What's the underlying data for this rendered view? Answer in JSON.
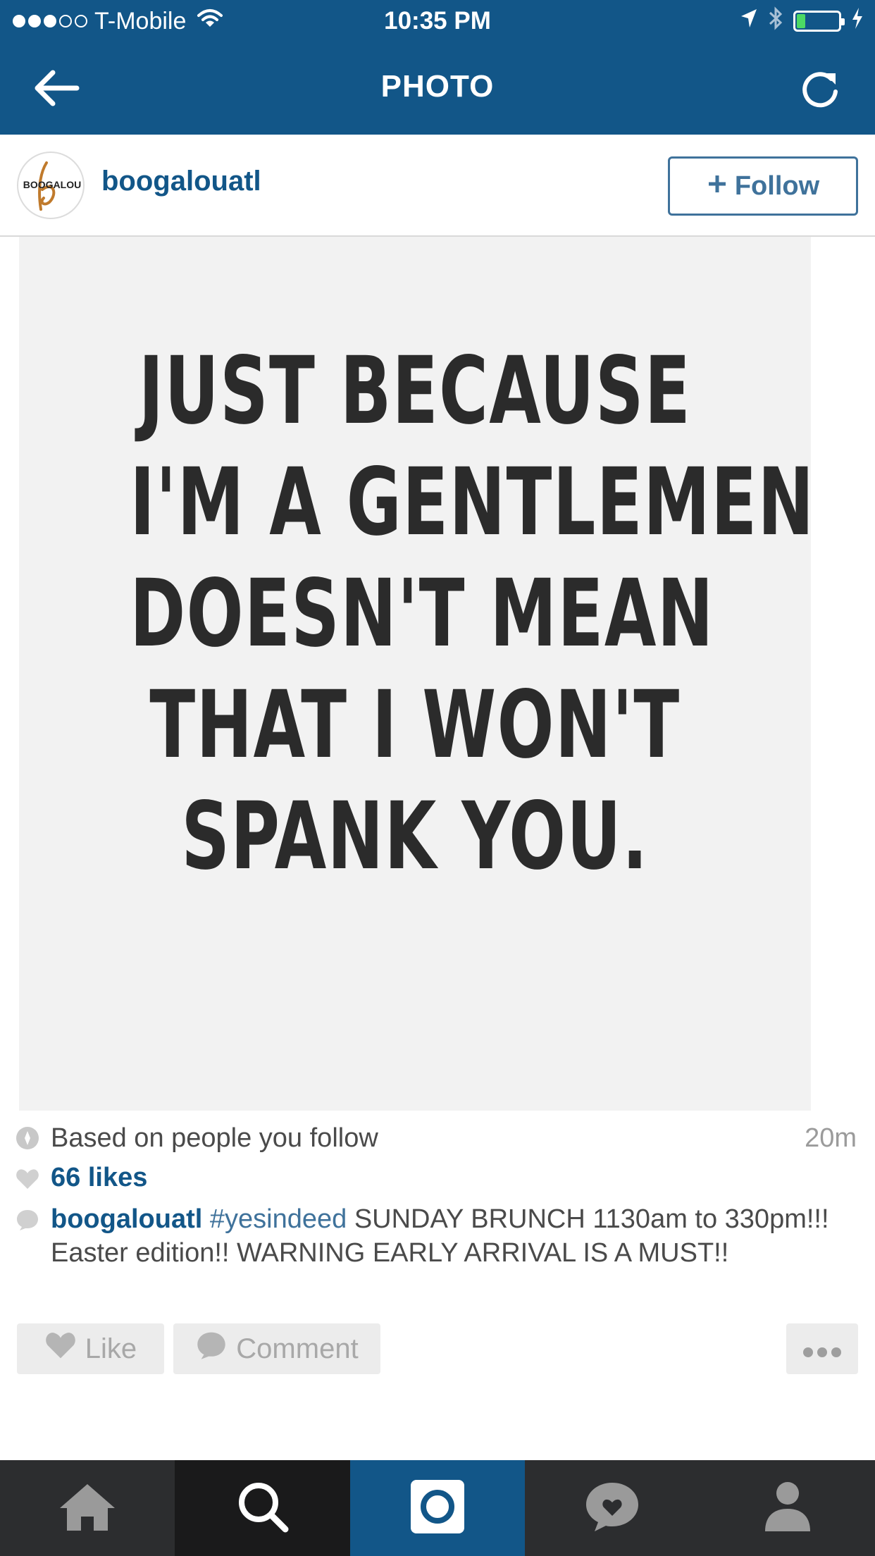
{
  "status_bar": {
    "carrier": "T-Mobile",
    "time": "10:35 PM",
    "signal_bars_filled": 3,
    "signal_bars_total": 5,
    "battery_level": 0.2,
    "icons": [
      "wifi-icon",
      "location-arrow-icon",
      "bluetooth-icon",
      "battery-icon",
      "charging-bolt-icon"
    ]
  },
  "nav": {
    "title": "PHOTO",
    "back_icon": "arrow-left-icon",
    "refresh_icon": "refresh-icon"
  },
  "post": {
    "username": "boogalouatl",
    "avatar_text": "BOOGALOU",
    "follow_label": "Follow",
    "follow_icon": "plus-icon",
    "image_text_lines": [
      "JUST BECAUSE",
      "I'M A GENTLEMEN",
      "DOESN'T MEAN",
      "THAT I WON'T",
      "SPANK YOU."
    ],
    "suggestion": "Based on people you follow",
    "time_ago": "20m",
    "likes": "66 likes",
    "caption_user": "boogalouatl",
    "caption_tag": "#yesindeed",
    "caption_text": " SUNDAY BRUNCH 1130am to 330pm!!! Easter edition!! WARNING EARLY ARRIVAL IS A MUST!!"
  },
  "actions": {
    "like_label": "Like",
    "comment_label": "Comment",
    "more_icon": "more-dots-icon"
  },
  "tab_bar": {
    "tabs": [
      {
        "name": "home",
        "icon": "home-icon"
      },
      {
        "name": "search",
        "icon": "search-icon"
      },
      {
        "name": "camera",
        "icon": "camera-icon"
      },
      {
        "name": "activity",
        "icon": "activity-heart-icon"
      },
      {
        "name": "profile",
        "icon": "profile-icon"
      }
    ],
    "active": "camera"
  },
  "colors": {
    "brand_blue": "#125688",
    "link_blue": "#3f729b",
    "tab_bar": "#2c2d2f",
    "battery_green": "#4cd964"
  }
}
